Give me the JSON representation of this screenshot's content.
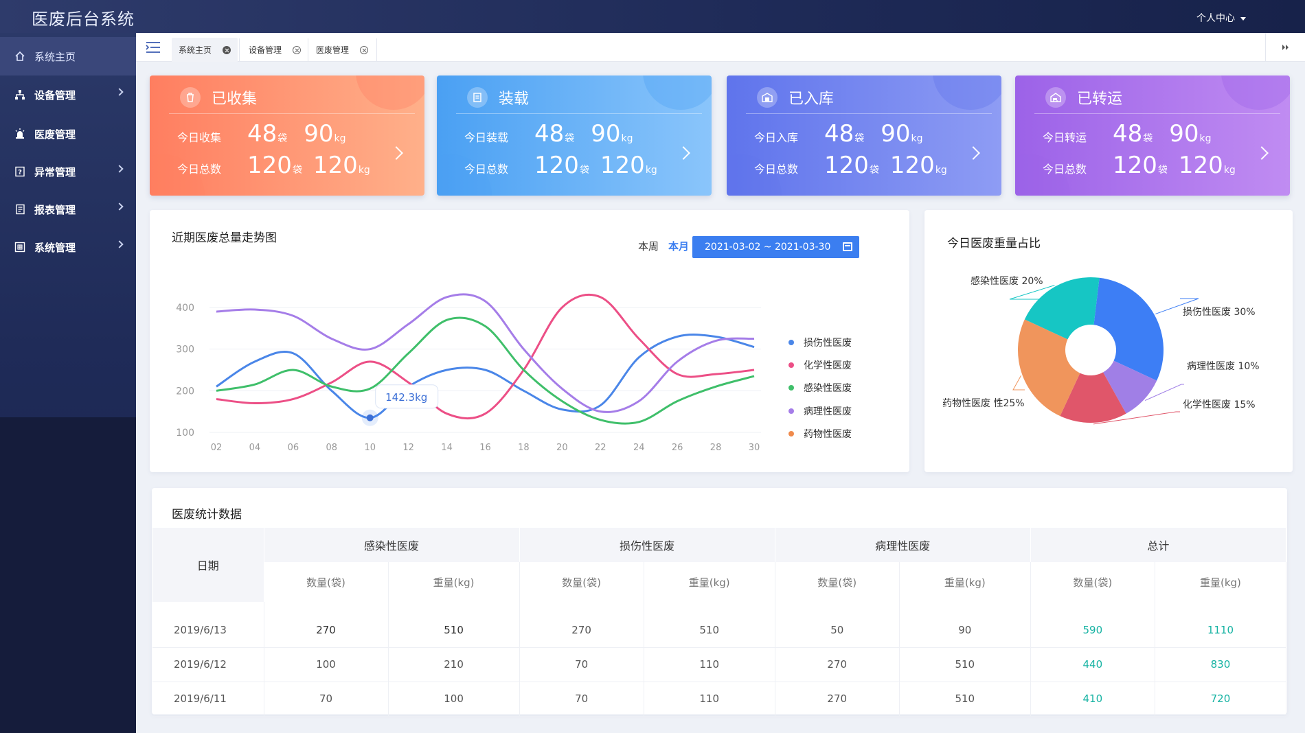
{
  "app": {
    "title": "医废后台系统",
    "user_menu": "个人中心"
  },
  "sidebar": {
    "items": [
      {
        "label": "系统主页",
        "icon": "home-icon",
        "active": true
      },
      {
        "label": "设备管理",
        "icon": "org-chart-icon",
        "has_children": true
      },
      {
        "label": "医废管理",
        "icon": "alarm-light-icon"
      },
      {
        "label": "异常管理",
        "icon": "help-book-icon",
        "has_children": true
      },
      {
        "label": "报表管理",
        "icon": "report-icon",
        "has_children": true
      },
      {
        "label": "系统管理",
        "icon": "system-grid-icon",
        "has_children": true
      }
    ]
  },
  "tabs": [
    {
      "label": "系统主页",
      "active": true
    },
    {
      "label": "设备管理"
    },
    {
      "label": "医废管理"
    }
  ],
  "cards": [
    {
      "title": "已收集",
      "icon": "trash-bin-icon",
      "row1_label": "今日收集",
      "row2_label": "今日总数",
      "bags_today": "48",
      "kg_today": "90",
      "bags_total": "120",
      "kg_total": "120",
      "color1": "#ff7e60",
      "color2": "#ffb08a"
    },
    {
      "title": "装载",
      "icon": "clipboard-icon",
      "row1_label": "今日装载",
      "row2_label": "今日总数",
      "bags_today": "48",
      "kg_today": "90",
      "bags_total": "120",
      "kg_total": "120",
      "color1": "#4aa0f3",
      "color2": "#8ac5fb"
    },
    {
      "title": "已入库",
      "icon": "warehouse-in-icon",
      "row1_label": "今日入库",
      "row2_label": "今日总数",
      "bags_today": "48",
      "kg_today": "90",
      "bags_total": "120",
      "kg_total": "120",
      "color1": "#5f74ec",
      "color2": "#8e9cf4"
    },
    {
      "title": "已转运",
      "icon": "truck-warehouse-icon",
      "row1_label": "今日转运",
      "row2_label": "今日总数",
      "bags_today": "48",
      "kg_today": "90",
      "bags_total": "120",
      "kg_total": "120",
      "color1": "#9c62e8",
      "color2": "#c08cf2"
    }
  ],
  "units": {
    "bag": "袋",
    "kg": "kg"
  },
  "trend": {
    "title": "近期医废总量走势图",
    "range_week": "本周",
    "range_month": "本月",
    "date_range": "2021-03-02 ~ 2021-03-30",
    "tooltip": "142.3kg"
  },
  "pie": {
    "title": "今日医废重量占比"
  },
  "colors": {
    "accent": "#3b7ef0",
    "total_text": "#17b3a3"
  },
  "chart_data": [
    {
      "type": "line",
      "x": [
        "02",
        "04",
        "06",
        "08",
        "10",
        "12",
        "14",
        "16",
        "18",
        "20",
        "22",
        "24",
        "26",
        "28",
        "30"
      ],
      "ylim": [
        100,
        400
      ],
      "yticks": [
        100,
        200,
        300,
        400
      ],
      "series": [
        {
          "name": "损伤性医废",
          "color": "#4a86e8",
          "values": [
            210,
            270,
            290,
            200,
            135,
            210,
            250,
            250,
            200,
            155,
            165,
            280,
            330,
            330,
            305
          ]
        },
        {
          "name": "化学性医废",
          "color": "#ec4f86",
          "values": [
            180,
            170,
            180,
            220,
            270,
            220,
            145,
            145,
            250,
            400,
            425,
            325,
            240,
            240,
            250
          ]
        },
        {
          "name": "感染性医废",
          "color": "#3fbf6a",
          "values": [
            200,
            215,
            250,
            210,
            205,
            290,
            370,
            355,
            250,
            175,
            130,
            125,
            175,
            210,
            235
          ]
        },
        {
          "name": "病理性医废",
          "color": "#a57de8",
          "values": [
            390,
            395,
            380,
            325,
            300,
            360,
            425,
            415,
            300,
            205,
            150,
            175,
            270,
            320,
            325
          ]
        },
        {
          "name": "药物性医废",
          "color": "#f08a4c",
          "values": []
        }
      ]
    },
    {
      "type": "pie",
      "series": [
        {
          "name": "损伤性医废",
          "label": "损伤性医废  30%",
          "value": 30,
          "color": "#3d7ef5"
        },
        {
          "name": "病理性医废",
          "label": "病理性医废  10%",
          "value": 10,
          "color": "#a07fe6"
        },
        {
          "name": "化学性医废",
          "label": "化学性医废  15%",
          "value": 15,
          "color": "#e0566a"
        },
        {
          "name": "药物性医废",
          "label": "药物性医废  性25%",
          "value": 25,
          "color": "#f0955c"
        },
        {
          "name": "感染性医废",
          "label": "感染性医废  20%",
          "value": 20,
          "color": "#16c6c4"
        }
      ]
    }
  ],
  "table": {
    "title": "医废统计数据",
    "date_header": "日期",
    "groups": [
      "感染性医废",
      "损伤性医废",
      "病理性医废",
      "总计"
    ],
    "sub_headers": [
      "数量(袋)",
      "重量(kg)"
    ],
    "rows": [
      {
        "date": "2019/6/13",
        "values": [
          "270",
          "510",
          "270",
          "510",
          "50",
          "90",
          "590",
          "1110"
        ]
      },
      {
        "date": "2019/6/12",
        "values": [
          "100",
          "210",
          "70",
          "110",
          "270",
          "510",
          "440",
          "830"
        ]
      },
      {
        "date": "2019/6/11",
        "values": [
          "70",
          "100",
          "70",
          "110",
          "270",
          "510",
          "410",
          "720"
        ]
      }
    ]
  }
}
